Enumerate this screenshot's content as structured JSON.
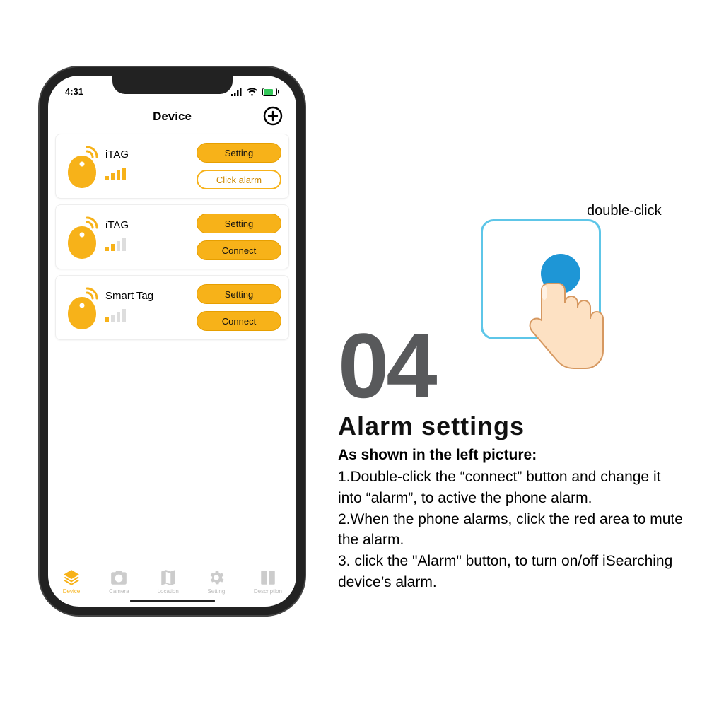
{
  "phone": {
    "status_time": "4:31",
    "title": "Device",
    "devices": [
      {
        "name": "iTAG",
        "signal_bars": 4,
        "btn1": "Setting",
        "btn2": "Click alarm",
        "btn2_outline": true
      },
      {
        "name": "iTAG",
        "signal_bars": 2,
        "btn1": "Setting",
        "btn2": "Connect",
        "btn2_outline": false
      },
      {
        "name": "Smart Tag",
        "signal_bars": 1,
        "btn1": "Setting",
        "btn2": "Connect",
        "btn2_outline": false
      }
    ],
    "bottom_nav": [
      {
        "label": "Device",
        "active": true
      },
      {
        "label": "Camera",
        "active": false
      },
      {
        "label": "Location",
        "active": false
      },
      {
        "label": "Setting",
        "active": false
      },
      {
        "label": "Description",
        "active": false
      }
    ]
  },
  "instructions": {
    "illus_label": "double-click",
    "step_num": "04",
    "title": "Alarm  settings",
    "subtitle": "As shown in the left picture:",
    "line1": "1.Double-click the “connect” button and change it into “alarm”, to active the phone alarm.",
    "line2": "2.When the phone alarms, click the red area to mute the alarm.",
    "line3": "3. click the \"Alarm\" button, to turn on/off iSearching device’s alarm."
  },
  "colors": {
    "accent": "#f7b219"
  }
}
